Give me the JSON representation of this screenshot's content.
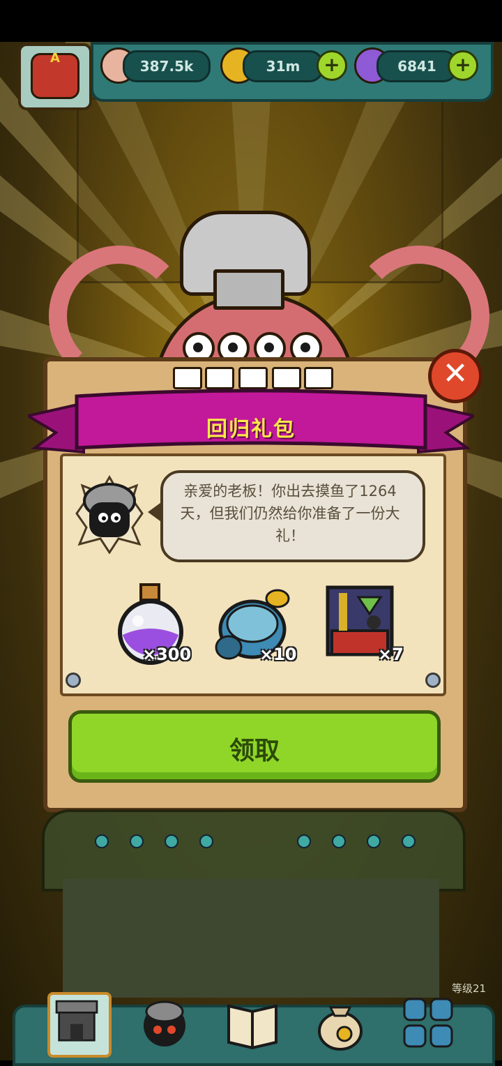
{
  "resources": {
    "eyeball": {
      "icon": "eyeball-icon",
      "value": "387.5k"
    },
    "coin": {
      "icon": "coin-icon",
      "value": "31m"
    },
    "potion": {
      "icon": "potion-icon",
      "value": "6841"
    }
  },
  "avatar": {
    "letter": "A"
  },
  "dialog": {
    "title": "回归礼包",
    "message": "亲爱的老板！你出去摸鱼了1264天，但我们仍然给你准备了一份大礼！",
    "rewards": [
      {
        "icon": "purple-potion-icon",
        "quantity": "×300"
      },
      {
        "icon": "coin-stack-icon",
        "quantity": "×10"
      },
      {
        "icon": "treasure-chest-icon",
        "quantity": "×7"
      }
    ],
    "claim_label": "领取"
  },
  "level_label": "等级21",
  "nav": [
    {
      "icon": "shop-icon",
      "selected": true
    },
    {
      "icon": "monster-icon",
      "selected": false
    },
    {
      "icon": "book-icon",
      "selected": false
    },
    {
      "icon": "money-bag-icon",
      "selected": false
    },
    {
      "icon": "grid-menu-icon",
      "selected": false
    }
  ],
  "colors": {
    "ribbon": "#c2189a",
    "claim_button": "#8fd628",
    "close_button": "#e0482b",
    "topbar": "#2f7a76"
  }
}
